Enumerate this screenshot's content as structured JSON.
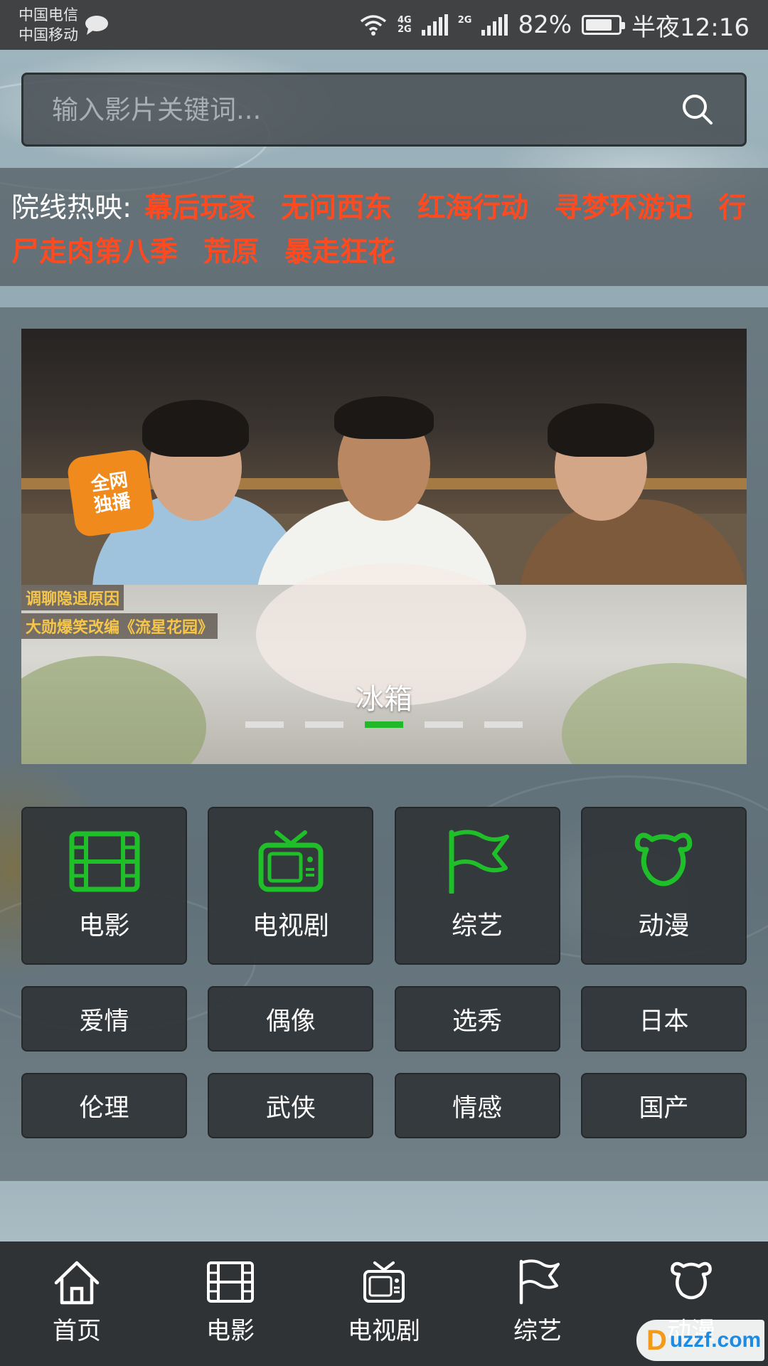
{
  "status_bar": {
    "carrier_1": "中国电信",
    "carrier_2": "中国移动",
    "network_1": "4G",
    "network_2": "2G",
    "network_3": "2G",
    "battery": "82%",
    "time": "半夜12:16"
  },
  "search": {
    "placeholder": "输入影片关键词..."
  },
  "hot": {
    "label": "院线热映:",
    "movies": [
      "幕后玩家",
      "无问西东",
      "红海行动",
      "寻梦环游记",
      "行尸走肉第八季",
      "荒原",
      "暴走狂花"
    ]
  },
  "banner": {
    "title": "冰箱",
    "badge_line1": "全网",
    "badge_line2": "独播",
    "promo_1": "调聊隐退原因",
    "promo_2": "大勋爆笑改编《流星花园》",
    "slide_count": 5,
    "active_index": 2
  },
  "categories": {
    "main": [
      {
        "label": "电影",
        "icon": "film-icon"
      },
      {
        "label": "电视剧",
        "icon": "tv-icon"
      },
      {
        "label": "综艺",
        "icon": "flag-icon"
      },
      {
        "label": "动漫",
        "icon": "bear-icon"
      }
    ],
    "row2": [
      "爱情",
      "偶像",
      "选秀",
      "日本"
    ],
    "row3": [
      "伦理",
      "武侠",
      "情感",
      "国产"
    ]
  },
  "nav": {
    "items": [
      {
        "label": "首页",
        "icon": "home-icon"
      },
      {
        "label": "电影",
        "icon": "film-icon"
      },
      {
        "label": "电视剧",
        "icon": "tv-icon"
      },
      {
        "label": "综艺",
        "icon": "flag-icon"
      },
      {
        "label": "动漫",
        "icon": "bear-icon"
      }
    ]
  },
  "watermark": {
    "text": "uzzf.com"
  },
  "colors": {
    "accent_green": "#21b82a",
    "hot_red": "#ff4a1f"
  }
}
